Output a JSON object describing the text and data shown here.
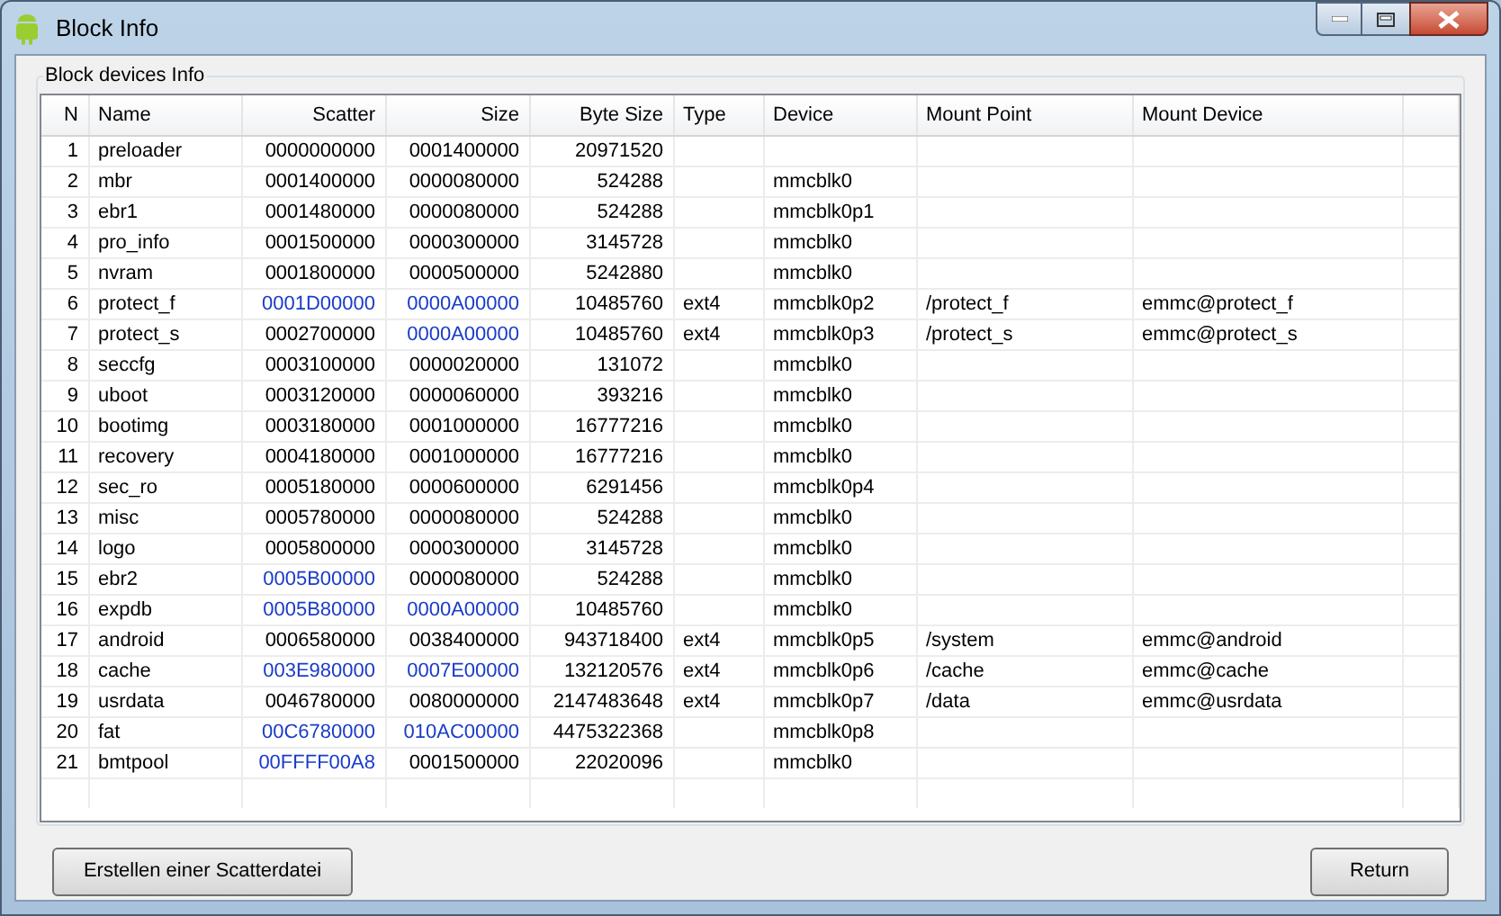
{
  "window": {
    "title": "Block Info"
  },
  "group": {
    "label": "Block devices Info"
  },
  "table": {
    "columns": [
      "N",
      "Name",
      "Scatter",
      "Size",
      "Byte Size",
      "Type",
      "Device",
      "Mount Point",
      "Mount Device"
    ],
    "rows": [
      {
        "n": "1",
        "name": "preloader",
        "scatter": {
          "text": "0000000000",
          "color": "#000000"
        },
        "size": {
          "text": "0001400000",
          "color": "#000000"
        },
        "byte_size": "20971520"
      },
      {
        "n": "2",
        "name": "mbr",
        "scatter": {
          "text": "0001400000",
          "color": "#000000"
        },
        "size": {
          "text": "0000080000",
          "color": "#000000"
        },
        "byte_size": "524288",
        "device": "mmcblk0"
      },
      {
        "n": "3",
        "name": "ebr1",
        "scatter": {
          "text": "0001480000",
          "color": "#000000"
        },
        "size": {
          "text": "0000080000",
          "color": "#000000"
        },
        "byte_size": "524288",
        "device": "mmcblk0p1"
      },
      {
        "n": "4",
        "name": "pro_info",
        "scatter": {
          "text": "0001500000",
          "color": "#000000"
        },
        "size": {
          "text": "0000300000",
          "color": "#000000"
        },
        "byte_size": "3145728",
        "device": "mmcblk0"
      },
      {
        "n": "5",
        "name": "nvram",
        "scatter": {
          "text": "0001800000",
          "color": "#000000"
        },
        "size": {
          "text": "0000500000",
          "color": "#000000"
        },
        "byte_size": "5242880",
        "device": "mmcblk0"
      },
      {
        "n": "6",
        "name": "protect_f",
        "scatter": {
          "text": "0001D00000",
          "color": "#1a3cc8"
        },
        "size": {
          "text": "0000A00000",
          "color": "#1a3cc8"
        },
        "byte_size": "10485760",
        "type": "ext4",
        "device": "mmcblk0p2",
        "mount_point": "/protect_f",
        "mount_device": "emmc@protect_f"
      },
      {
        "n": "7",
        "name": "protect_s",
        "scatter": {
          "text": "0002700000",
          "color": "#000000"
        },
        "size": {
          "text": "0000A00000",
          "color": "#1a3cc8"
        },
        "byte_size": "10485760",
        "type": "ext4",
        "device": "mmcblk0p3",
        "mount_point": "/protect_s",
        "mount_device": "emmc@protect_s"
      },
      {
        "n": "8",
        "name": "seccfg",
        "scatter": {
          "text": "0003100000",
          "color": "#000000"
        },
        "size": {
          "text": "0000020000",
          "color": "#000000"
        },
        "byte_size": "131072",
        "device": "mmcblk0"
      },
      {
        "n": "9",
        "name": "uboot",
        "scatter": {
          "text": "0003120000",
          "color": "#000000"
        },
        "size": {
          "text": "0000060000",
          "color": "#000000"
        },
        "byte_size": "393216",
        "device": "mmcblk0"
      },
      {
        "n": "10",
        "name": "bootimg",
        "scatter": {
          "text": "0003180000",
          "color": "#000000"
        },
        "size": {
          "text": "0001000000",
          "color": "#000000"
        },
        "byte_size": "16777216",
        "device": "mmcblk0"
      },
      {
        "n": "11",
        "name": "recovery",
        "scatter": {
          "text": "0004180000",
          "color": "#000000"
        },
        "size": {
          "text": "0001000000",
          "color": "#000000"
        },
        "byte_size": "16777216",
        "device": "mmcblk0"
      },
      {
        "n": "12",
        "name": "sec_ro",
        "scatter": {
          "text": "0005180000",
          "color": "#000000"
        },
        "size": {
          "text": "0000600000",
          "color": "#000000"
        },
        "byte_size": "6291456",
        "device": "mmcblk0p4"
      },
      {
        "n": "13",
        "name": "misc",
        "scatter": {
          "text": "0005780000",
          "color": "#000000"
        },
        "size": {
          "text": "0000080000",
          "color": "#000000"
        },
        "byte_size": "524288",
        "device": "mmcblk0"
      },
      {
        "n": "14",
        "name": "logo",
        "scatter": {
          "text": "0005800000",
          "color": "#000000"
        },
        "size": {
          "text": "0000300000",
          "color": "#000000"
        },
        "byte_size": "3145728",
        "device": "mmcblk0"
      },
      {
        "n": "15",
        "name": "ebr2",
        "scatter": {
          "text": "0005B00000",
          "color": "#1a3cc8"
        },
        "size": {
          "text": "0000080000",
          "color": "#000000"
        },
        "byte_size": "524288",
        "device": "mmcblk0"
      },
      {
        "n": "16",
        "name": "expdb",
        "scatter": {
          "text": "0005B80000",
          "color": "#1a3cc8"
        },
        "size": {
          "text": "0000A00000",
          "color": "#1a3cc8"
        },
        "byte_size": "10485760",
        "device": "mmcblk0"
      },
      {
        "n": "17",
        "name": "android",
        "scatter": {
          "text": "0006580000",
          "color": "#000000"
        },
        "size": {
          "text": "0038400000",
          "color": "#000000"
        },
        "byte_size": "943718400",
        "type": "ext4",
        "device": "mmcblk0p5",
        "mount_point": "/system",
        "mount_device": "emmc@android"
      },
      {
        "n": "18",
        "name": "cache",
        "scatter": {
          "text": "003E980000",
          "color": "#1a3cc8"
        },
        "size": {
          "text": "0007E00000",
          "color": "#1a3cc8"
        },
        "byte_size": "132120576",
        "type": "ext4",
        "device": "mmcblk0p6",
        "mount_point": "/cache",
        "mount_device": "emmc@cache"
      },
      {
        "n": "19",
        "name": "usrdata",
        "scatter": {
          "text": "0046780000",
          "color": "#000000"
        },
        "size": {
          "text": "0080000000",
          "color": "#000000"
        },
        "byte_size": "2147483648",
        "type": "ext4",
        "device": "mmcblk0p7",
        "mount_point": "/data",
        "mount_device": "emmc@usrdata"
      },
      {
        "n": "20",
        "name": "fat",
        "scatter": {
          "text": "00C6780000",
          "color": "#1a3cc8"
        },
        "size": {
          "text": "010AC00000",
          "color": "#1a3cc8"
        },
        "byte_size": "4475322368",
        "device": "mmcblk0p8"
      },
      {
        "n": "21",
        "name": "bmtpool",
        "scatter": {
          "text": "00FFFF00A8",
          "color": "#1a3cc8"
        },
        "size": {
          "text": "0001500000",
          "color": "#000000"
        },
        "byte_size": "22020096",
        "device": "mmcblk0"
      }
    ]
  },
  "buttons": [
    {
      "label": "Erstellen einer Scatterdatei",
      "kind": "left"
    },
    {
      "label": "Return",
      "kind": "right"
    }
  ]
}
